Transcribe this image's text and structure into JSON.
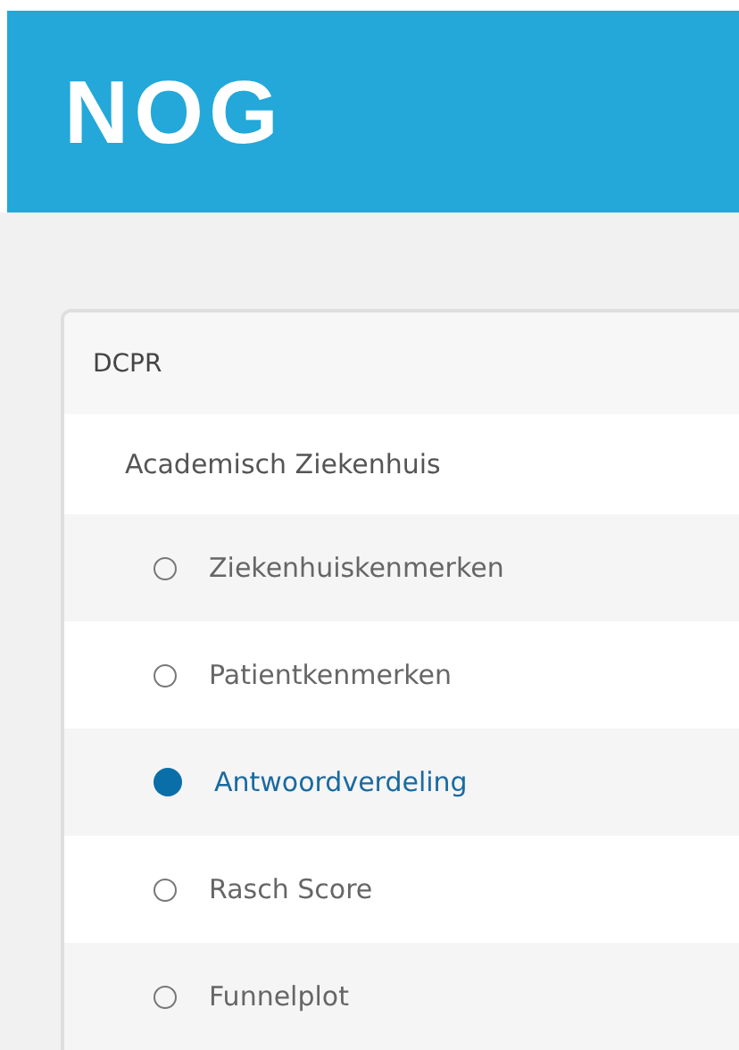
{
  "header": {
    "logo": "NOG"
  },
  "card": {
    "title": "DCPR",
    "section": "Academisch Ziekenhuis",
    "items": [
      {
        "label": "Ziekenhuiskenmerken",
        "selected": false
      },
      {
        "label": "Patientkenmerken",
        "selected": false
      },
      {
        "label": "Antwoordverdeling",
        "selected": true
      },
      {
        "label": "Rasch Score",
        "selected": false
      },
      {
        "label": "Funnelplot",
        "selected": false
      }
    ]
  }
}
